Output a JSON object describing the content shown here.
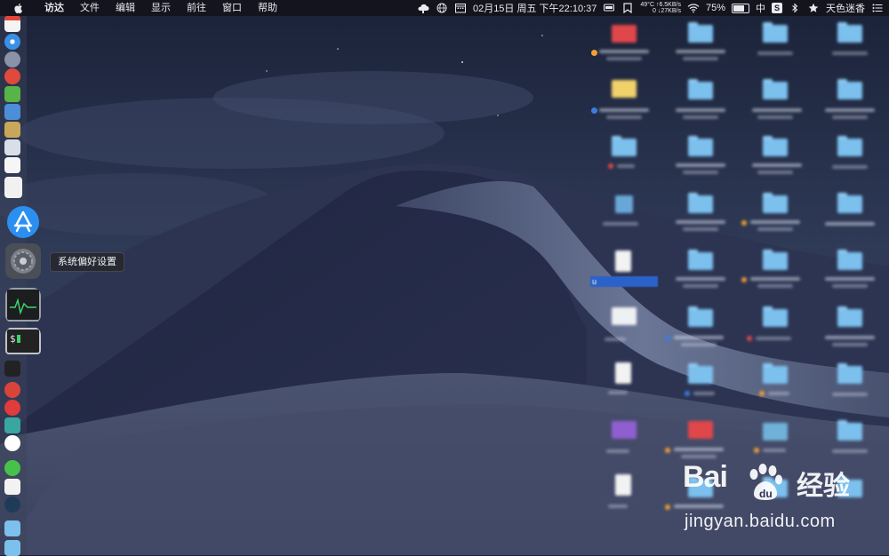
{
  "menubar": {
    "app_name": "访达",
    "menus": [
      "文件",
      "编辑",
      "显示",
      "前往",
      "窗口",
      "帮助"
    ],
    "network": {
      "temp": "49°C",
      "up": "↑6.5KB/s",
      "down_count": "0",
      "down": "↓27KB/s"
    },
    "datetime": "02月15日 周五 下午22:10:37",
    "battery_percent": "75%",
    "battery_level": 0.75,
    "ime": "中",
    "s_badge": "S",
    "user_name": "天色迷香"
  },
  "tooltip": {
    "label": "系统偏好设置"
  },
  "desktop": {
    "selected_label": "u"
  },
  "watermark": {
    "brand": "Bai",
    "brand_suffix": "du",
    "product": "经验",
    "url": "jingyan.baidu.com"
  },
  "icons": {
    "apple": "apple-logo-icon",
    "dock_highlighted": "system-preferences-icon",
    "app_store": "app-store-icon",
    "activity_monitor": "activity-monitor-icon",
    "terminal": "terminal-icon"
  }
}
